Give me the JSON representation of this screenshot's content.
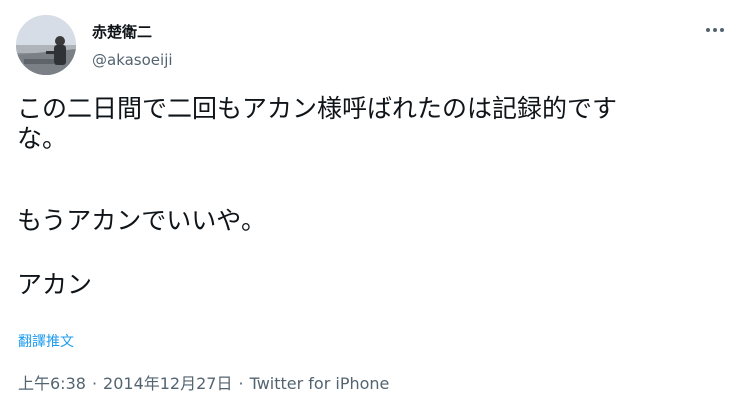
{
  "user": {
    "display_name": "赤楚衛二",
    "handle": "@akasoeiji"
  },
  "tweet": {
    "line1": "この二日間で二回もアカン様呼ばれたのは記録的です",
    "line2": "な。",
    "line3": "もうアカンでいいや。",
    "line4": "アカン"
  },
  "translate_label": "翻譯推文",
  "meta": {
    "time": "上午6:38",
    "separator1": "·",
    "date": "2014年12月27日",
    "separator2": "·",
    "source": "Twitter for iPhone"
  },
  "icons": {
    "more": "more-horizontal-icon"
  }
}
